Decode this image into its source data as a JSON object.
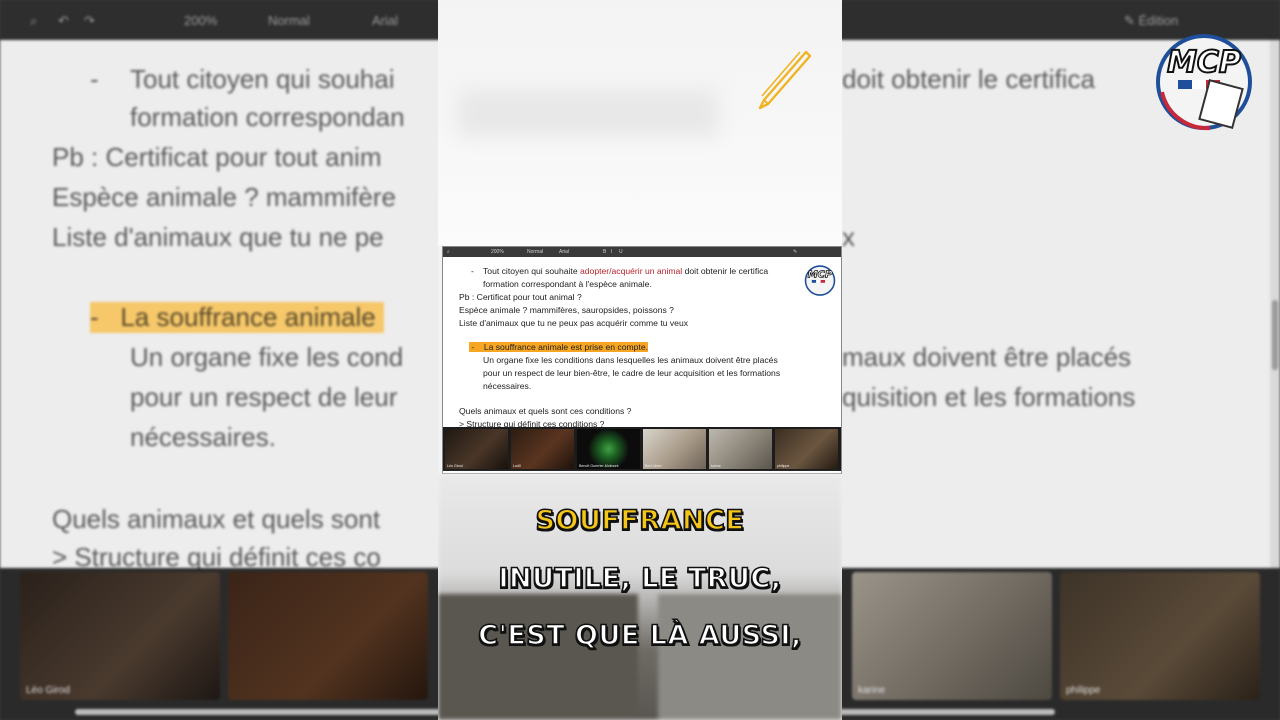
{
  "toolbar": {
    "zoom": "200%",
    "style": "Normal",
    "font": "Arial",
    "mode": "Édition"
  },
  "document": {
    "bullet1_prefix": "Tout citoyen qui souhaite ",
    "bullet1_red": "adopter/acquérir un animal",
    "bullet1_suffix": " doit obtenir le certifica",
    "bullet1_line2": "formation correspondant à l'espèce animale.",
    "pb": "Pb : Certificat pour tout animal ?",
    "espece": "Espèce animale ? mammifères, sauropsides, poissons ?",
    "liste": "Liste d'animaux que tu ne peux pas acquérir comme tu veux",
    "souffrance_hl": "La souffrance animale est prise en compte.",
    "organe1": "Un organe fixe les conditions dans lesquelles les animaux doivent être placés",
    "organe2": "pour un respect de leur bien-être, le cadre de leur acquisition et les formations",
    "organe3": "nécessaires.",
    "quels": "Quels animaux et quels sont ces conditions ?",
    "structure": "> Structure qui définit ces conditions ?",
    "bullet_dash": "-"
  },
  "background_text": {
    "b1a": "Tout citoyen qui souhai",
    "b1b": "doit obtenir le certifica",
    "b2": "formation correspondan",
    "pb": "Pb : Certificat pour tout anim",
    "esp": "Espèce animale ? mammifère",
    "liste": "Liste d'animaux que tu ne pe",
    "liste_end": "x",
    "souf": "La souffrance animale",
    "org1": "Un organe fixe les cond",
    "org1b": "maux doivent être placés",
    "org2": "pour un respect de leur",
    "org2b": "quisition et les formations",
    "org3": "nécessaires.",
    "quels": "Quels animaux et quels sont",
    "struct": "> Structure qui définit ces co"
  },
  "participants": [
    {
      "name": "Léo Girod"
    },
    {
      "name": "Lud0"
    },
    {
      "name": "Benoît Guerrier-Molmont"
    },
    {
      "name": "Bert Libert"
    },
    {
      "name": "karine"
    },
    {
      "name": "philippe"
    }
  ],
  "logo": {
    "text": "MCP"
  },
  "captions": {
    "line1": "SOUFFRANCE",
    "line2": "INUTILE, LE TRUC,",
    "line3": "C'EST QUE LÀ AUSSI,"
  },
  "colors": {
    "caption_highlight": "#f5c518",
    "doc_highlight": "#f6a623",
    "link_red": "#b5232f"
  }
}
